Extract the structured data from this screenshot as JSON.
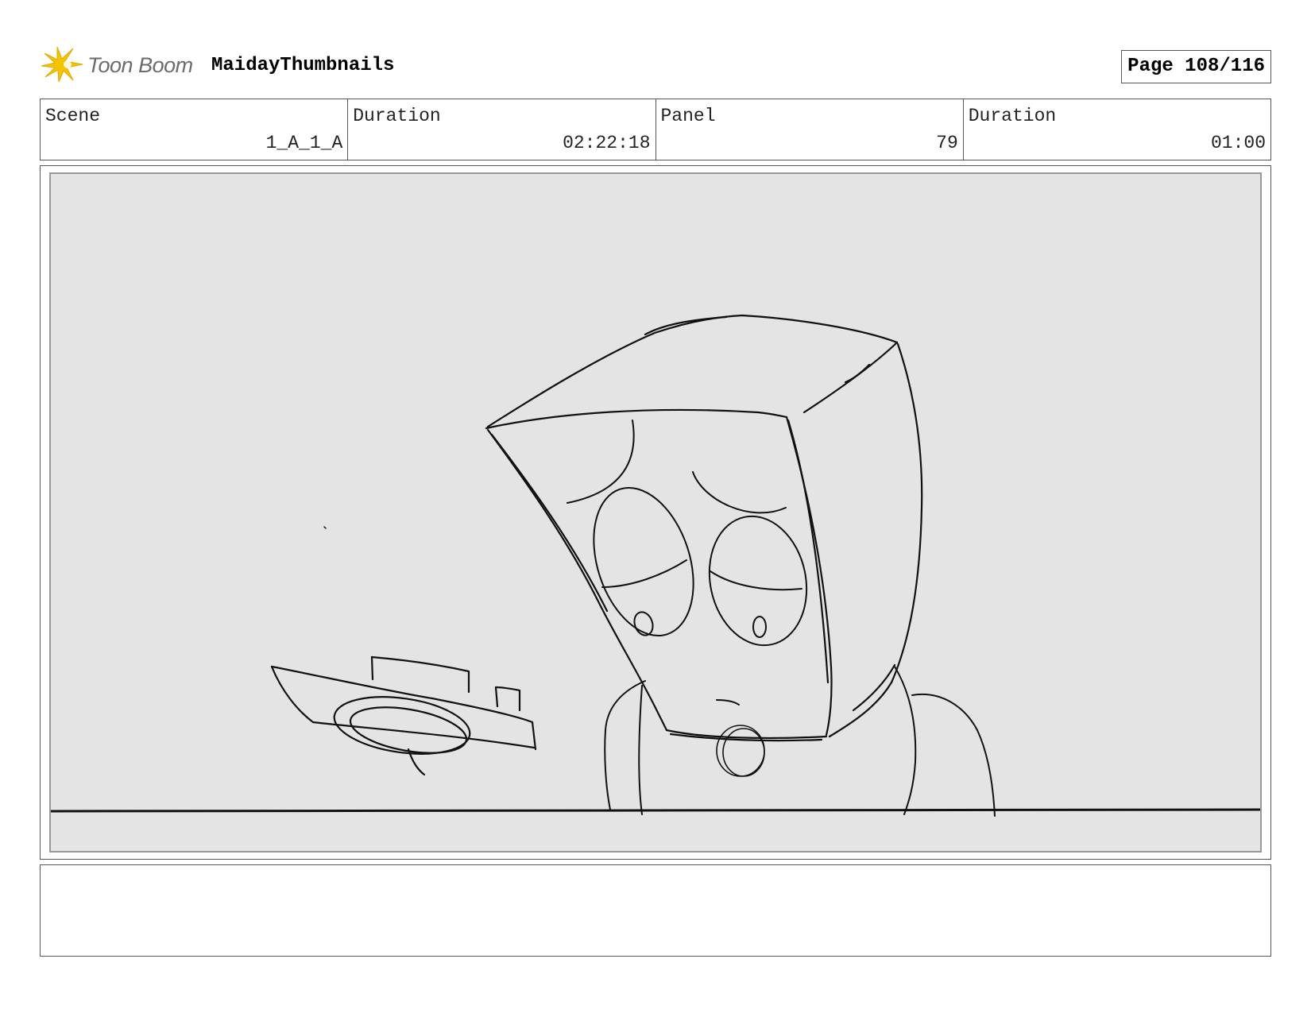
{
  "header": {
    "logo_text": "Toon Boom",
    "project_title": "MaidayThumbnails",
    "page_label": "Page 108/116"
  },
  "info": {
    "scene_label": "Scene",
    "scene_value": "1_A_1_A",
    "scene_duration_label": "Duration",
    "scene_duration_value": "02:22:18",
    "panel_label": "Panel",
    "panel_value": "79",
    "panel_duration_label": "Duration",
    "panel_duration_value": "01:00"
  },
  "notes": {
    "text": ""
  },
  "colors": {
    "logo_accent": "#f5c400",
    "panel_background": "#e4e4e4"
  }
}
